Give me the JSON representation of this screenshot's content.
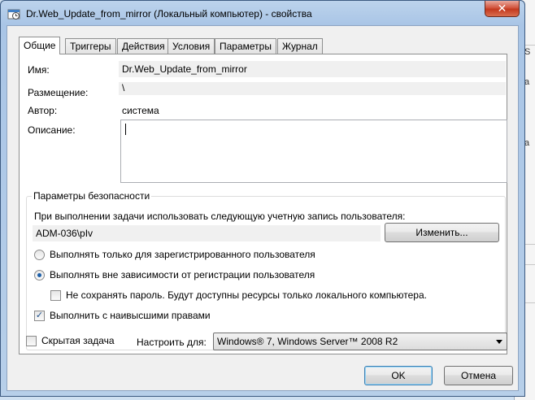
{
  "window": {
    "title": "Dr.Web_Update_from_mirror (Локальный компьютер) - свойства",
    "close_symbol": "✕"
  },
  "tabs": [
    {
      "label": "Общие",
      "active": true
    },
    {
      "label": "Триггеры",
      "active": false
    },
    {
      "label": "Действия",
      "active": false
    },
    {
      "label": "Условия",
      "active": false
    },
    {
      "label": "Параметры",
      "active": false
    },
    {
      "label": "Журнал",
      "active": false
    }
  ],
  "general": {
    "name_label": "Имя:",
    "name_value": "Dr.Web_Update_from_mirror",
    "location_label": "Размещение:",
    "location_value": "\\",
    "author_label": "Автор:",
    "author_value": "система",
    "description_label": "Описание:",
    "description_value": ""
  },
  "security": {
    "group_title": "Параметры безопасности",
    "account_prompt": "При выполнении задачи использовать следующую учетную запись пользователя:",
    "account_value": "ADM-036\\pIv",
    "change_button": "Изменить...",
    "radio_logged_on": "Выполнять только для зарегистрированного пользователя",
    "radio_any": "Выполнять вне зависимости от регистрации пользователя",
    "selected_radio": "any",
    "no_store_password": "Не сохранять пароль. Будут доступны ресурсы только локального компьютера.",
    "no_store_password_checked": false,
    "highest_privileges": "Выполнить с наивысшими правами",
    "highest_privileges_checked": true
  },
  "bottom": {
    "hidden_task": "Скрытая задача",
    "hidden_task_checked": false,
    "configure_for_label": "Настроить для:",
    "configure_for_value": "Windows® 7, Windows Server™ 2008 R2"
  },
  "buttons": {
    "ok": "OK",
    "cancel": "Отмена"
  },
  "background_window": {
    "chars": [
      "S",
      "а",
      "а"
    ]
  },
  "colors": {
    "title_gradient_top": "#bcd3ec",
    "close_red": "#c4391f",
    "selection_blue": "#1d5fa8"
  }
}
